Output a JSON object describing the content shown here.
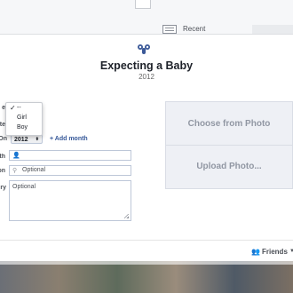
{
  "header": {
    "recent_label": "Recent"
  },
  "event": {
    "title": "Expecting a Baby",
    "year": "2012"
  },
  "gender_dropdown": {
    "options": [
      "--",
      "Girl",
      "Boy"
    ],
    "selected": "--"
  },
  "calendar_link_partial": "ar",
  "year_select": {
    "value": "2012",
    "arrows": "⬍"
  },
  "add_month_label": "+ Add month",
  "row_labels": {
    "gender": "e",
    "date": "te",
    "when": "On",
    "with": "th",
    "location": "on",
    "story": "ry"
  },
  "fields": {
    "with": {
      "placeholder": ""
    },
    "location": {
      "placeholder": "Optional"
    },
    "story": {
      "placeholder": "Optional"
    }
  },
  "photo_buttons": {
    "choose": "Choose from Photo",
    "upload": "Upload Photo..."
  },
  "audience": {
    "label": "Friends"
  }
}
